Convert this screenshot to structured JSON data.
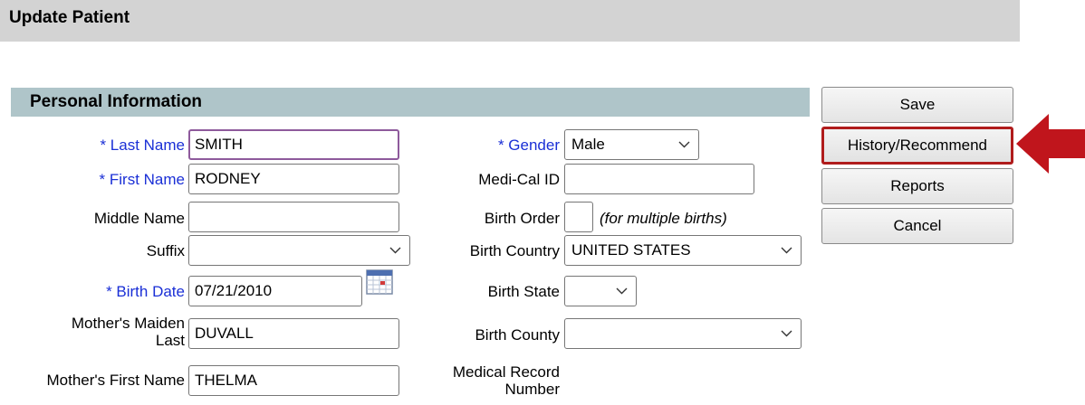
{
  "header": {
    "title": "Update Patient"
  },
  "section": {
    "title": "Personal Information"
  },
  "left": {
    "last_name": {
      "label": "* Last Name",
      "value": "SMITH"
    },
    "first_name": {
      "label": "* First Name",
      "value": "RODNEY"
    },
    "middle_name": {
      "label": "Middle Name",
      "value": ""
    },
    "suffix": {
      "label": "Suffix",
      "value": ""
    },
    "birth_date": {
      "label": "* Birth Date",
      "value": "07/21/2010"
    },
    "mother_maiden": {
      "label_line1": "Mother's Maiden",
      "label_line2": "Last",
      "value": "DUVALL"
    },
    "mother_first": {
      "label": "Mother's First Name",
      "value": "THELMA"
    }
  },
  "right": {
    "gender": {
      "label": "* Gender",
      "value": "Male"
    },
    "medi_cal": {
      "label": "Medi-Cal ID",
      "value": ""
    },
    "birth_order": {
      "label": "Birth Order",
      "value": "",
      "note": "(for multiple births)"
    },
    "birth_country": {
      "label": "Birth Country",
      "value": "UNITED STATES"
    },
    "birth_state": {
      "label": "Birth State",
      "value": ""
    },
    "birth_county": {
      "label": "Birth County",
      "value": ""
    },
    "medical_record": {
      "label_line1": "Medical Record",
      "label_line2": "Number"
    }
  },
  "actions": {
    "save": "Save",
    "history": "History/Recommend",
    "reports": "Reports",
    "cancel": "Cancel"
  },
  "icons": {
    "calendar": "calendar-icon",
    "chevron": "chevron-down-icon",
    "pointer": "red-arrow-icon"
  },
  "colors": {
    "required_label": "#1a2fd6",
    "highlight_border": "#b01c1c",
    "arrow": "#c0151c"
  }
}
